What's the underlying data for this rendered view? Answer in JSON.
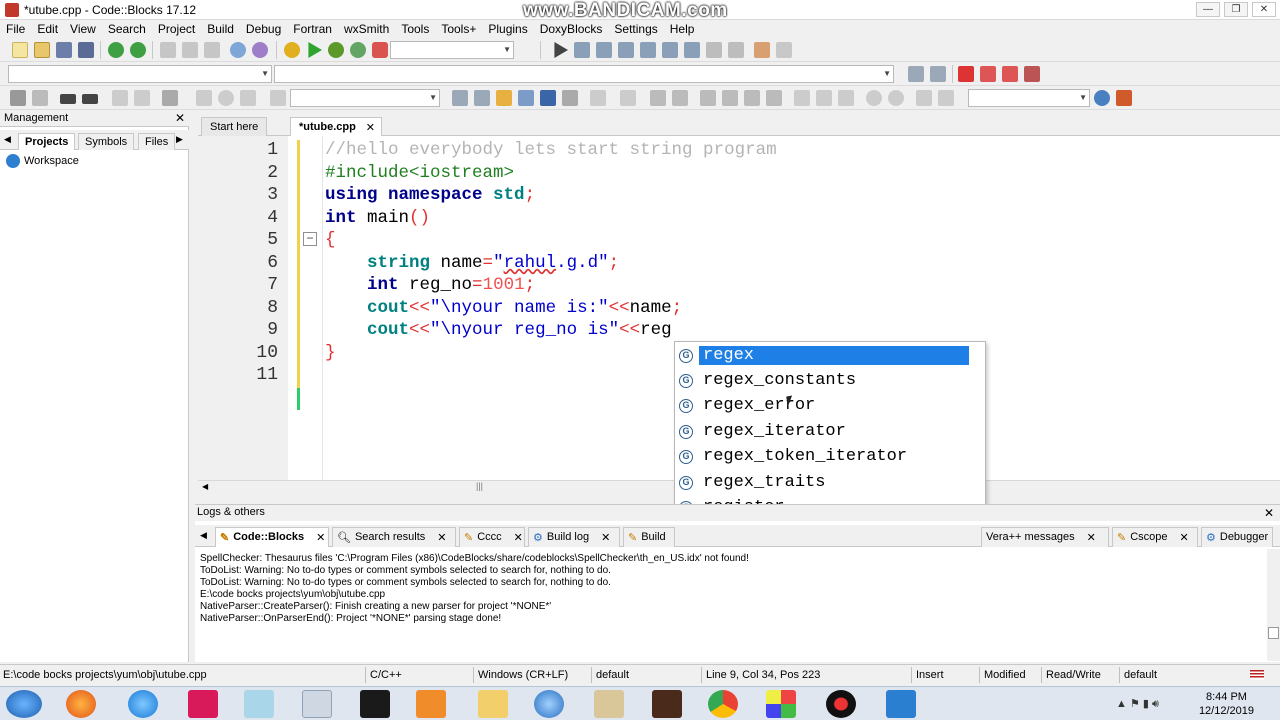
{
  "window": {
    "title": "*utube.cpp - Code::Blocks 17.12",
    "watermark": "www.BANDICAM.com",
    "buttons": [
      "—",
      "❐",
      "✕"
    ]
  },
  "menu": [
    "File",
    "Edit",
    "View",
    "Search",
    "Project",
    "Build",
    "Debug",
    "Fortran",
    "wxSmith",
    "Tools",
    "Tools+",
    "Plugins",
    "DoxyBlocks",
    "Settings",
    "Help"
  ],
  "management": {
    "title": "Management",
    "close": "✕",
    "tabs": [
      "Projects",
      "Symbols",
      "Files"
    ],
    "tree_root": "Workspace"
  },
  "editor": {
    "tabs": [
      {
        "label": "Start here"
      },
      {
        "label": "*utube.cpp",
        "close": "✕"
      }
    ],
    "line_numbers": [
      "1",
      "2",
      "3",
      "4",
      "5",
      "6",
      "7",
      "8",
      "9",
      "10",
      "11"
    ],
    "fold_marker": "−"
  },
  "autocomplete": {
    "icon": "G",
    "items": [
      "regex",
      "regex_constants",
      "regex_error",
      "regex_iterator",
      "regex_token_iterator",
      "regex_traits",
      "register"
    ]
  },
  "logs": {
    "title": "Logs & others",
    "close": "✕",
    "tabs": [
      "Code::Blocks",
      "Search results",
      "Cccc",
      "Build log",
      "Build",
      "Vera++ messages",
      "Cscope",
      "Debugger"
    ],
    "lines": [
      "SpellChecker: Thesaurus files 'C:\\Program Files (x86)\\CodeBlocks/share/codeblocks\\SpellChecker\\th_en_US.idx' not found!",
      "ToDoList: Warning: No to-do types or comment symbols selected to search for, nothing to do.",
      "ToDoList: Warning: No to-do types or comment symbols selected to search for, nothing to do.",
      "E:\\code bocks projects\\yum\\obj\\utube.cpp",
      "NativeParser::CreateParser(): Finish creating a new parser for project '*NONE*'",
      "NativeParser::OnParserEnd(): Project '*NONE*' parsing stage done!"
    ]
  },
  "status": {
    "path": "E:\\code bocks projects\\yum\\obj\\utube.cpp",
    "lang": "C/C++",
    "eol": "Windows (CR+LF)",
    "encoding": "default",
    "position": "Line 9, Col 34, Pos 223",
    "mode": "Insert",
    "modified": "Modified",
    "rw": "Read/Write",
    "profile": "default"
  },
  "taskbar": {
    "time": "8:44 PM",
    "date": "12/12/2019"
  },
  "colors": {
    "selection": "#1e7fe6",
    "comment": "#b4b4b4",
    "keyword": "#00008b",
    "preprocessor": "#208020",
    "string": "#0000cd",
    "number": "#f05050"
  }
}
